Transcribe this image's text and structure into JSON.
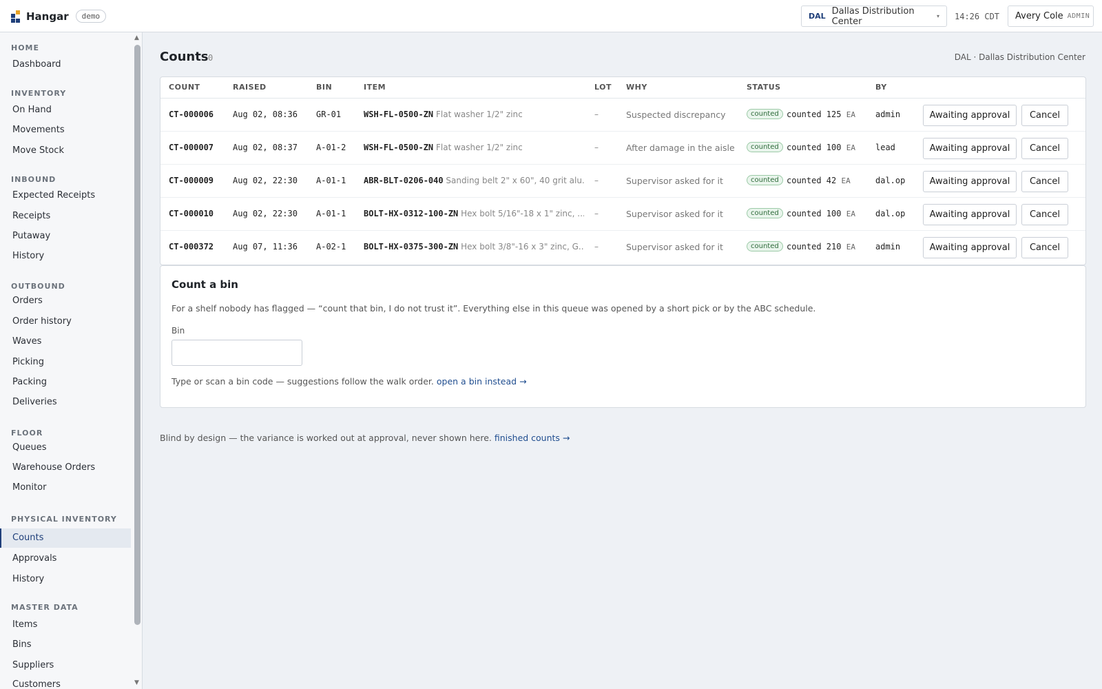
{
  "app": {
    "name": "Hangar",
    "env": "demo"
  },
  "topbar": {
    "site_code": "DAL",
    "site_name": "Dallas Distribution Center",
    "caret": "▾",
    "time": "14:26 CDT",
    "user_name": "Avery Cole",
    "user_role": "ADMIN"
  },
  "sidebar": {
    "sections": [
      {
        "label": "HOME",
        "items": [
          "Dashboard"
        ]
      },
      {
        "label": "INVENTORY",
        "items": [
          "On Hand",
          "Movements",
          "Move Stock"
        ]
      },
      {
        "label": "INBOUND",
        "items": [
          "Expected Receipts",
          "Receipts",
          "Putaway",
          "History"
        ]
      },
      {
        "label": "OUTBOUND",
        "items": [
          "Orders",
          "Order history",
          "Waves",
          "Picking",
          "Packing",
          "Deliveries"
        ]
      },
      {
        "label": "FLOOR",
        "items": [
          "Queues",
          "Warehouse Orders",
          "Monitor"
        ]
      },
      {
        "label": "PHYSICAL INVENTORY",
        "items": [
          "Counts",
          "Approvals",
          "History"
        ]
      },
      {
        "label": "MASTER DATA",
        "items": [
          "Items",
          "Bins",
          "Suppliers",
          "Customers"
        ]
      }
    ],
    "active_item": "Counts"
  },
  "page": {
    "title": "Counts",
    "count": "0",
    "site_label": "DAL · Dallas Distribution Center"
  },
  "table": {
    "headers": [
      "COUNT",
      "RAISED",
      "BIN",
      "ITEM",
      "LOT",
      "WHY",
      "STATUS",
      "BY"
    ],
    "rows": [
      {
        "count": "CT-000006",
        "raised": "Aug 02, 08:36",
        "bin": "GR-01",
        "sku": "WSH-FL-0500-ZN",
        "desc": "Flat washer 1/2\" zinc",
        "lot": "–",
        "why": "Suspected discrepancy",
        "badge": "counted",
        "status_text": "counted 125",
        "unit": "EA",
        "by": "admin",
        "approve": "Awaiting approval",
        "cancel": "Cancel"
      },
      {
        "count": "CT-000007",
        "raised": "Aug 02, 08:37",
        "bin": "A-01-2",
        "sku": "WSH-FL-0500-ZN",
        "desc": "Flat washer 1/2\" zinc",
        "lot": "–",
        "why": "After damage in the aisle",
        "badge": "counted",
        "status_text": "counted 100",
        "unit": "EA",
        "by": "lead",
        "approve": "Awaiting approval",
        "cancel": "Cancel"
      },
      {
        "count": "CT-000009",
        "raised": "Aug 02, 22:30",
        "bin": "A-01-1",
        "sku": "ABR-BLT-0206-040",
        "desc": "Sanding belt 2\" x 60\", 40 grit alu...",
        "lot": "–",
        "why": "Supervisor asked for it",
        "badge": "counted",
        "status_text": "counted 42",
        "unit": "EA",
        "by": "dal.op",
        "approve": "Awaiting approval",
        "cancel": "Cancel"
      },
      {
        "count": "CT-000010",
        "raised": "Aug 02, 22:30",
        "bin": "A-01-1",
        "sku": "BOLT-HX-0312-100-ZN",
        "desc": "Hex bolt 5/16\"-18 x 1\" zinc, ...",
        "lot": "–",
        "why": "Supervisor asked for it",
        "badge": "counted",
        "status_text": "counted 100",
        "unit": "EA",
        "by": "dal.op",
        "approve": "Awaiting approval",
        "cancel": "Cancel"
      },
      {
        "count": "CT-000372",
        "raised": "Aug 07, 11:36",
        "bin": "A-02-1",
        "sku": "BOLT-HX-0375-300-ZN",
        "desc": "Hex bolt 3/8\"-16 x 3\" zinc, G...",
        "lot": "–",
        "why": "Supervisor asked for it",
        "badge": "counted",
        "status_text": "counted 210",
        "unit": "EA",
        "by": "admin",
        "approve": "Awaiting approval",
        "cancel": "Cancel"
      }
    ]
  },
  "count_form": {
    "title": "Count a bin",
    "description": "For a shelf nobody has flagged — “count that bin, I do not trust it”. Everything else in this queue was opened by a short pick or by the ABC schedule.",
    "bin_label": "Bin",
    "bin_value": "",
    "hint": "Type or scan a bin code — suggestions follow the walk order.",
    "hint_link": "open a bin instead →"
  },
  "footer": {
    "note": "Blind by design — the variance is worked out at approval, never shown here.",
    "link": "finished counts →"
  },
  "icons": {
    "logo": "hangar-logo-icon",
    "scroll_up": "▲",
    "scroll_down": "▼"
  },
  "colors": {
    "accent": "#1f3f7a",
    "status_green": "#2f6b3b"
  }
}
